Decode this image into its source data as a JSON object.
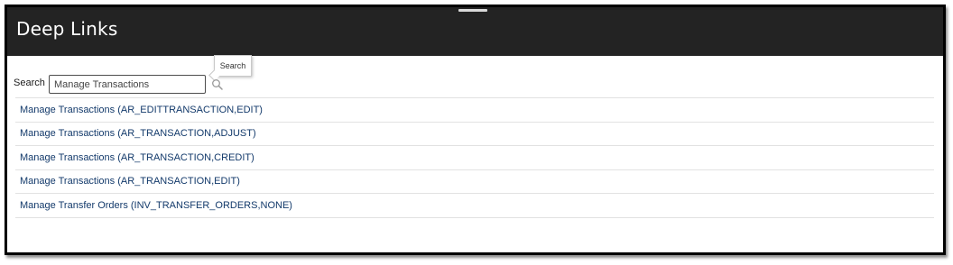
{
  "header": {
    "title": "Deep Links"
  },
  "search": {
    "label": "Search",
    "value": "Manage Transactions",
    "tooltip": "Search",
    "icon": "search-icon"
  },
  "results": [
    {
      "label": "Manage Transactions (AR_EDITTRANSACTION,EDIT)"
    },
    {
      "label": "Manage Transactions (AR_TRANSACTION,ADJUST)"
    },
    {
      "label": "Manage Transactions (AR_TRANSACTION,CREDIT)"
    },
    {
      "label": "Manage Transactions (AR_TRANSACTION,EDIT)"
    },
    {
      "label": "Manage Transfer Orders (INV_TRANSFER_ORDERS,NONE)"
    }
  ],
  "colors": {
    "header_bg": "#232323",
    "link": "#133a6b",
    "divider": "#e2e2e2"
  }
}
